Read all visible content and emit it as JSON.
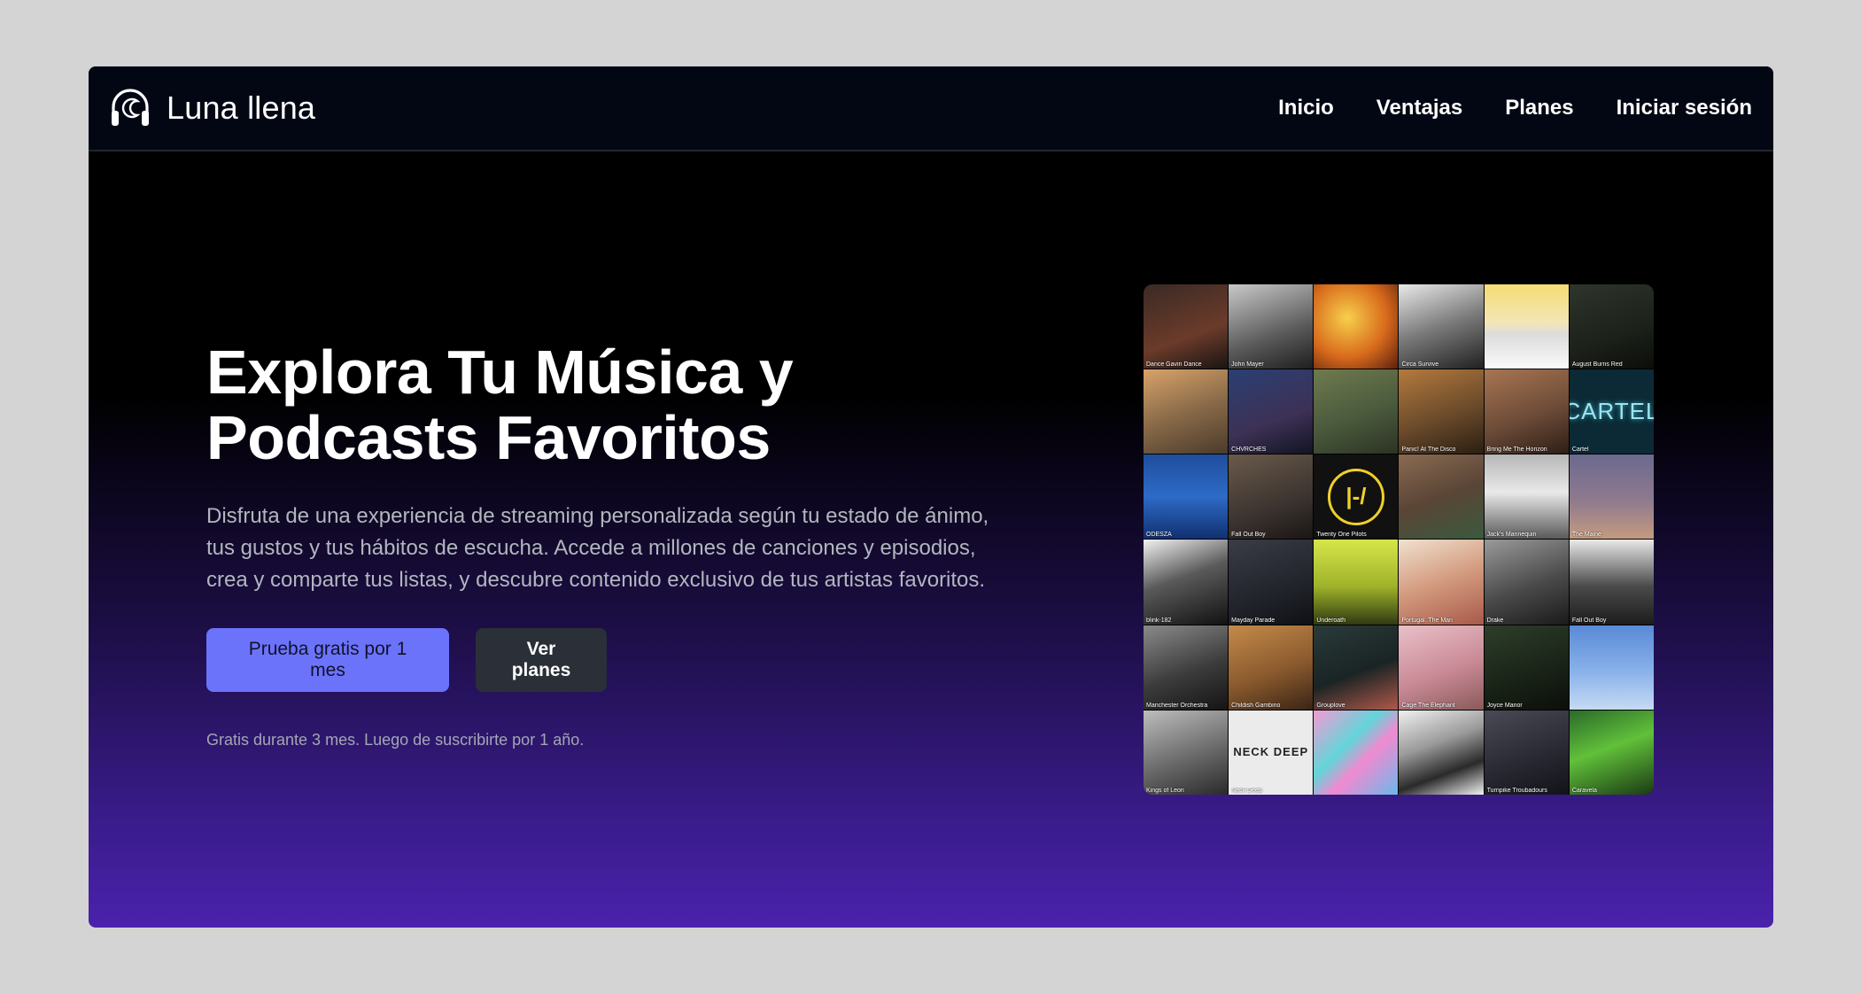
{
  "brand": {
    "name": "Luna llena",
    "icon": "headphones-moon-icon"
  },
  "nav": [
    {
      "label": "Inicio"
    },
    {
      "label": "Ventajas"
    },
    {
      "label": "Planes"
    },
    {
      "label": "Iniciar sesión"
    }
  ],
  "hero": {
    "title_line1": "Explora Tu Música y",
    "title_line2": "Podcasts Favoritos",
    "description": "Disfruta de una experiencia de streaming personalizada según tu estado de ánimo, tus gustos y tus hábitos de escucha. Accede a millones de canciones y episodios, crea y comparte tus listas, y descubre contenido exclusivo de tus artistas favoritos.",
    "primary_button": "Prueba gratis por 1 mes",
    "secondary_button": "Ver planes",
    "fine_print": "Gratis durante 3 mes. Luego de suscribirte por 1 año."
  },
  "colors": {
    "accent": "#6c73fb",
    "nav_bg": "#030714",
    "secondary_button": "#2a2f38",
    "gradient_bottom": "#4a22ac"
  },
  "album_grid": [
    {
      "label": "Dance Gavin Dance",
      "bg": "linear-gradient(160deg,#3a2a24,#6b3b2a 60%,#1a1412)"
    },
    {
      "label": "John Mayer",
      "bg": "linear-gradient(160deg,#c9c9c9,#5a5a5a 60%,#1e1e1e)"
    },
    {
      "label": "",
      "bg": "radial-gradient(circle at 40% 40%,#f7d04b,#d86a1c 55%,#5b1f0d)"
    },
    {
      "label": "Circa Survive",
      "bg": "linear-gradient(160deg,#e9e9e9,#7a7a7a 50%,#202020)"
    },
    {
      "label": "",
      "bg": "linear-gradient(180deg,#f6dc74 0%,#f2e7b5 45%,#dcdcdc 60%,#fafafa 100%)"
    },
    {
      "label": "August Burns Red",
      "bg": "linear-gradient(160deg,#2e352c,#1c2119 60%,#0b0d0a)"
    },
    {
      "label": "",
      "bg": "linear-gradient(160deg,#d8a36a,#8a6b49 50%,#4b3b2b)"
    },
    {
      "label": "CHVRCHES",
      "bg": "linear-gradient(160deg,#2a3f73,#3d3155 60%,#111422)"
    },
    {
      "label": "",
      "bg": "linear-gradient(160deg,#6f7a4e,#4a5a3c 55%,#2c3324)"
    },
    {
      "label": "Panic! At The Disco",
      "bg": "linear-gradient(160deg,#b47a3c,#6b4b2b 55%,#2b1e12)"
    },
    {
      "label": "Bring Me The Horizon",
      "bg": "linear-gradient(160deg,#a87552,#6d4c38 55%,#2d1e16)"
    },
    {
      "label": "Cartel",
      "text": "CARTEL",
      "bg": "#0b2a36"
    },
    {
      "label": "ODESZA",
      "bg": "linear-gradient(180deg,#1f4d9c 0%,#2d6bc7 50%,#123070 100%)"
    },
    {
      "label": "Fall Out Boy",
      "bg": "linear-gradient(160deg,#6a5a4a,#3c3430 60%,#1a1614)"
    },
    {
      "label": "Twenty One Pilots",
      "text": "|-/",
      "bg": "#111111"
    },
    {
      "label": "",
      "bg": "linear-gradient(160deg,#8a6b52,#5a4536 50%,#3a5a3e)"
    },
    {
      "label": "Jack's Mannequin",
      "bg": "linear-gradient(180deg,#b7b7b7,#e9e9e9 45%,#5a5a5a)"
    },
    {
      "label": "The Maine",
      "bg": "linear-gradient(180deg,#6b6a8e,#8f7a8e 55%,#c49b7e)"
    },
    {
      "label": "blink-182",
      "bg": "linear-gradient(160deg,#f2f2f2,#5a5a5a 45%,#111111)"
    },
    {
      "label": "Mayday Parade",
      "bg": "linear-gradient(160deg,#3a3c46,#22242c 60%,#0f1014)"
    },
    {
      "label": "Underoath",
      "bg": "linear-gradient(180deg,#d6e64a,#9fb22a 55%,#2f3a12)"
    },
    {
      "label": "Portugal. The Man",
      "bg": "linear-gradient(160deg,#f0e1cf,#d39a7e 50%,#a85a4a)"
    },
    {
      "label": "Drake",
      "bg": "linear-gradient(160deg,#9a9a9a,#4a4a4a 55%,#1a1a1a)"
    },
    {
      "label": "Fall Out Boy",
      "bg": "linear-gradient(180deg,#e9e9e9,#4a4a4a 55%,#1c1c1c)"
    },
    {
      "label": "Manchester Orchestra",
      "bg": "linear-gradient(160deg,#8a8a8a,#3c3c3c 55%,#141414)"
    },
    {
      "label": "Childish Gambino",
      "bg": "linear-gradient(160deg,#c48a4a,#8a5a2e 55%,#3a2416)"
    },
    {
      "label": "Grouplove",
      "bg": "linear-gradient(160deg,#2a3a3a,#1a2424 55%,#b0584a)"
    },
    {
      "label": "Cage The Elephant",
      "bg": "linear-gradient(160deg,#e9c0c8,#c98a96 55%,#8a5a5a)"
    },
    {
      "label": "Joyce Manor",
      "bg": "linear-gradient(160deg,#2e3e2a,#1a2418 55%,#0b0f0a)"
    },
    {
      "label": "",
      "bg": "linear-gradient(180deg,#5a8ad6,#8ab2ea 55%,#c6daf2)"
    },
    {
      "label": "Kings of Leon",
      "bg": "linear-gradient(160deg,#bdbdbd,#6a6a6a 55%,#2a2a2a)"
    },
    {
      "label": "Neck Deep",
      "text": "NECK DEEP",
      "bg": "#ebebeb"
    },
    {
      "label": "",
      "bg": "linear-gradient(135deg,#f59ad2,#62d5d9 40%,#f18ad0 60%,#6ab8ec)"
    },
    {
      "label": "",
      "bg": "linear-gradient(160deg,#f0f0f0,#9a9a9a 40%,#2a2a2a 70%,#f2f2f2)"
    },
    {
      "label": "Turnpike Troubadours",
      "bg": "linear-gradient(160deg,#4a4a56,#2a2a34 55%,#121218)"
    },
    {
      "label": "Caravela",
      "bg": "linear-gradient(160deg,#2a6a2a,#61c03a 45%,#1a3a14)"
    }
  ]
}
